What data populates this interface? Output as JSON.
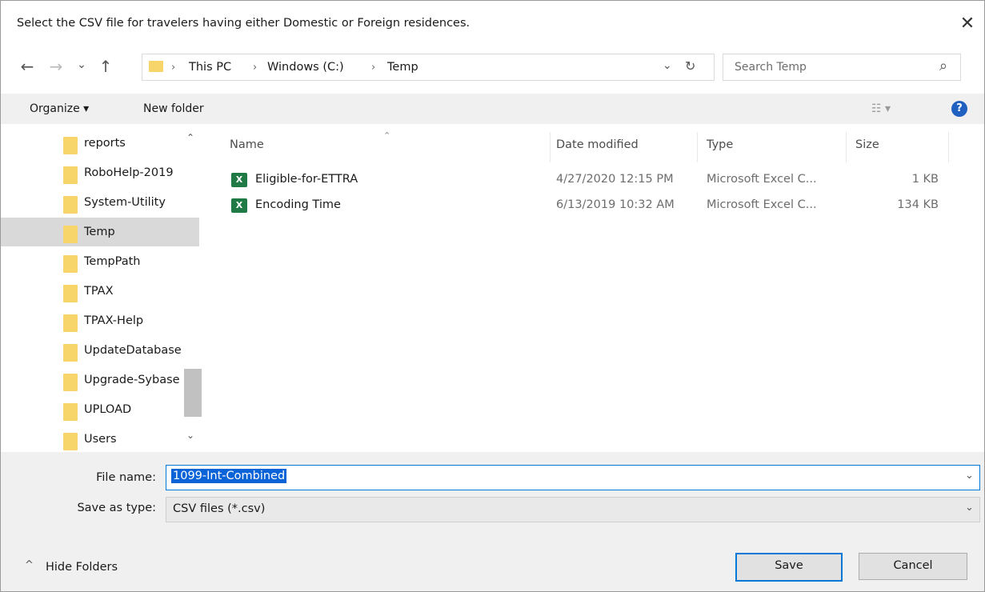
{
  "dialog": {
    "title": "Select the CSV file for travelers having either Domestic or Foreign residences.",
    "close_label": "✕"
  },
  "nav": {
    "back": "←",
    "forward": "→",
    "recent": "⌄",
    "up": "↑",
    "refresh": "↻",
    "breadcrumb": [
      "This PC",
      "Windows (C:)",
      "Temp"
    ],
    "breadcrumb_sep": "›",
    "dropdown": "⌄",
    "search_placeholder": "Search Temp",
    "search_icon": "⌕"
  },
  "toolbar": {
    "organize": "Organize ▾",
    "new_folder": "New folder",
    "view": "☷ ▾",
    "help": "?"
  },
  "sidebar": {
    "items": [
      {
        "label": "reports"
      },
      {
        "label": "RoboHelp-2019"
      },
      {
        "label": "System-Utility"
      },
      {
        "label": "Temp",
        "selected": true
      },
      {
        "label": "TempPath"
      },
      {
        "label": "TPAX"
      },
      {
        "label": "TPAX-Help"
      },
      {
        "label": "UpdateDatabase"
      },
      {
        "label": "Upgrade-Sybase"
      },
      {
        "label": "UPLOAD"
      },
      {
        "label": "Users"
      }
    ],
    "scroll_up": "⌃",
    "scroll_down": "⌄"
  },
  "files": {
    "columns": [
      "Name",
      "Date modified",
      "Type",
      "Size"
    ],
    "sort_indicator": "⌃",
    "rows": [
      {
        "name": "Eligible-for-ETTRA",
        "date": "4/27/2020 12:15 PM",
        "type": "Microsoft Excel C...",
        "size": "1 KB"
      },
      {
        "name": "Encoding Time",
        "date": "6/13/2019 10:32 AM",
        "type": "Microsoft Excel C...",
        "size": "134 KB"
      }
    ],
    "icon_letter": "X"
  },
  "form": {
    "file_name_label": "File name:",
    "file_name_value": "1099-Int-Combined",
    "save_type_label": "Save as type:",
    "save_type_value": "CSV files (*.csv)",
    "dropdown": "⌄"
  },
  "footer": {
    "hide_folders": "Hide Folders",
    "hide_chevron": "^",
    "save": "Save",
    "cancel": "Cancel"
  }
}
